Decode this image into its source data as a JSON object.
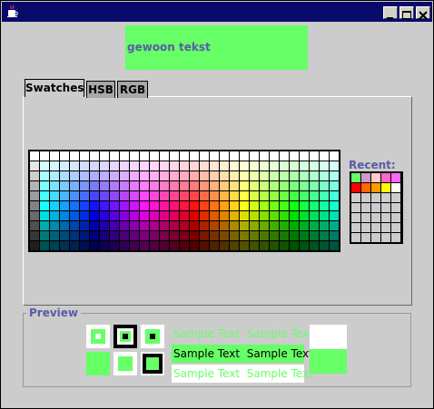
{
  "window": {
    "icon": "java-cup-icon",
    "controls": [
      "minimize",
      "maximize",
      "close"
    ]
  },
  "sample_text": {
    "label": "gewoon tekst",
    "background": "#66ff66",
    "color": "#5a5aa8"
  },
  "tabs": [
    {
      "label": "Swatches",
      "selected": true
    },
    {
      "label": "HSB",
      "selected": false
    },
    {
      "label": "RGB",
      "selected": false
    }
  ],
  "recent": {
    "label": "Recent:",
    "colors": [
      "#66ff66",
      "#cc99cc",
      "#ffcccc",
      "#ff66cc",
      "#ff66ff",
      "#ff0000",
      "#ff6600",
      "#ff9900",
      "#ffff00",
      "#ffffff"
    ]
  },
  "preview": {
    "title": "Preview",
    "color": "#66ff66",
    "sample_text": "Sample Text"
  }
}
